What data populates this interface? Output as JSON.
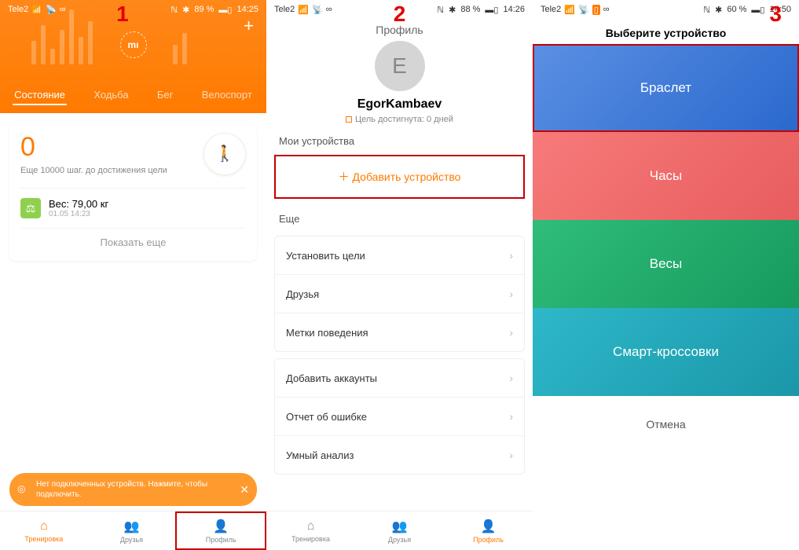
{
  "phone1": {
    "step_number": "1",
    "status": {
      "carrier": "Tele2",
      "nfc": "ℕ",
      "bt": "✱",
      "battery": "89 %",
      "time": "14:25"
    },
    "plus": "+",
    "mi": "mı",
    "tabs": {
      "status": "Состояние",
      "walk": "Ходьба",
      "run": "Бег",
      "bike": "Велоспорт"
    },
    "steps": {
      "count": "0",
      "sub": "Еще 10000 шаг. до достижения цели"
    },
    "weight": {
      "label": "Вес: 79,00  кг",
      "date": "01.05 14:23"
    },
    "show_more": "Показать еще",
    "toast": "Нет подключенных устройств. Нажмите, чтобы подключить.",
    "nav": {
      "train": "Тренировка",
      "friends": "Друзья",
      "profile": "Профиль"
    }
  },
  "phone2": {
    "step_number": "2",
    "status": {
      "carrier": "Tele2",
      "nfc": "ℕ",
      "bt": "✱",
      "battery": "88 %",
      "time": "14:26"
    },
    "title": "Профиль",
    "avatar_letter": "E",
    "username": "EgorKambaev",
    "goal": "Цель достигнута: 0 дней",
    "my_devices": "Мои устройства",
    "add_device": "Добавить устройство",
    "more_label": "Еще",
    "list1": {
      "goals": "Установить цели",
      "friends": "Друзья",
      "tags": "Метки поведения"
    },
    "list2": {
      "accounts": "Добавить аккаунты",
      "report": "Отчет об ошибке",
      "smart": "Умный анализ"
    },
    "nav": {
      "train": "Тренировка",
      "friends": "Друзья",
      "profile": "Профиль"
    }
  },
  "phone3": {
    "step_number": "3",
    "status": {
      "carrier": "Tele2",
      "nfc": "ℕ",
      "bt": "✱",
      "battery": "60 %",
      "time": "14:50"
    },
    "title": "Выберите устройство",
    "tiles": {
      "bracelet": "Браслет",
      "watch": "Часы",
      "scale": "Весы",
      "shoes": "Смарт-кроссовки"
    },
    "cancel": "Отмена"
  }
}
